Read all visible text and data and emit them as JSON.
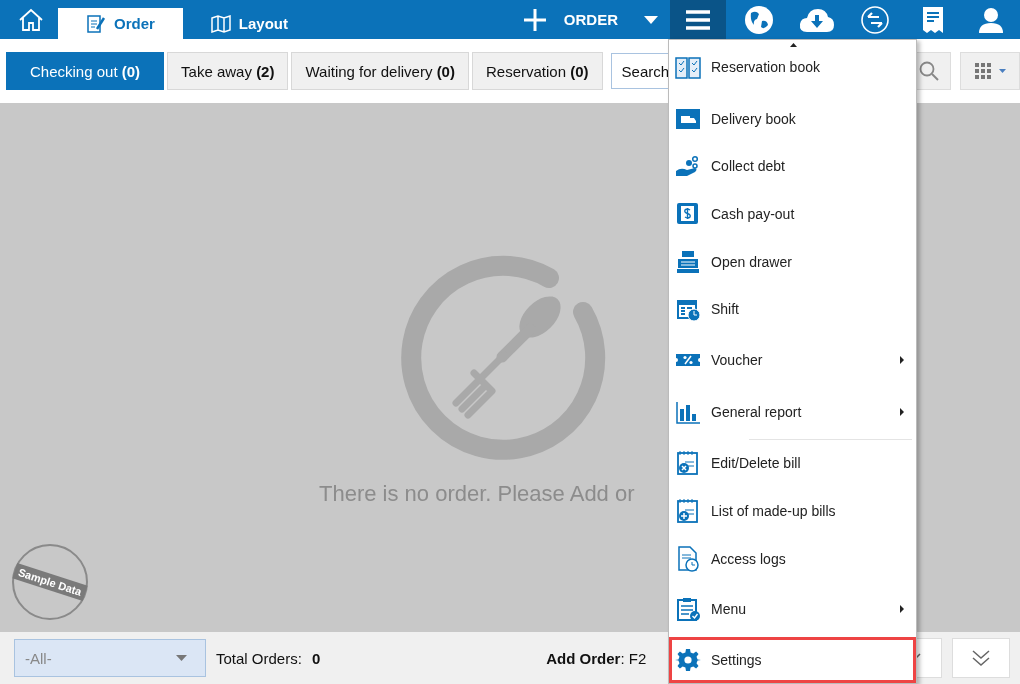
{
  "top_bar": {
    "tabs": [
      {
        "kind": "home",
        "selected": false
      },
      {
        "kind": "order",
        "label": "Order",
        "selected": true
      },
      {
        "kind": "layout",
        "label": "Layout",
        "selected": false
      }
    ],
    "add_button": {
      "label": "ORDER"
    },
    "icons": [
      {
        "kind": "menu",
        "selected": true
      },
      {
        "kind": "globe",
        "selected": false
      },
      {
        "kind": "cloud",
        "selected": false
      },
      {
        "kind": "sync",
        "selected": false
      },
      {
        "kind": "receipt",
        "selected": false
      },
      {
        "kind": "user",
        "selected": false
      }
    ]
  },
  "order_tabs": [
    {
      "label": "Checking out **(0)**",
      "selected": true
    },
    {
      "label": "Take away **(2)**",
      "selected": false
    },
    {
      "label": "Waiting for delivery **(0)**",
      "selected": false
    },
    {
      "label": "Reservation **(0)**",
      "selected": false
    }
  ],
  "search": {
    "placeholder": "Search"
  },
  "empty_message": "There is no order. Please Add or",
  "sample_stamp": "Sample Data",
  "footer": {
    "filter": "-All-",
    "total_label": "Total Orders:",
    "total_value": "0",
    "shortcut": "**Add Order**: F2"
  },
  "menu": [
    {
      "kind": "reservation",
      "label": "Reservation book",
      "submenu": false,
      "highlighted": false
    },
    {
      "kind": "delivery",
      "label": "Delivery book",
      "submenu": false,
      "highlighted": false
    },
    {
      "kind": "debt",
      "label": "Collect debt",
      "submenu": false,
      "highlighted": false
    },
    {
      "kind": "payout",
      "label": "Cash pay-out",
      "submenu": false,
      "highlighted": false
    },
    {
      "kind": "drawer",
      "label": "Open drawer",
      "submenu": false,
      "highlighted": false
    },
    {
      "kind": "shift",
      "label": "Shift",
      "submenu": false,
      "highlighted": false
    },
    {
      "kind": "voucher",
      "label": "Voucher",
      "submenu": true,
      "highlighted": false
    },
    {
      "kind": "report",
      "label": "General report",
      "submenu": true,
      "highlighted": false
    },
    {
      "kind": "divider"
    },
    {
      "kind": "editbill",
      "label": "Edit/Delete bill",
      "submenu": false,
      "highlighted": false
    },
    {
      "kind": "madeup",
      "label": "List of made-up bills",
      "submenu": false,
      "highlighted": false
    },
    {
      "kind": "logs",
      "label": "Access logs",
      "submenu": false,
      "highlighted": false
    },
    {
      "kind": "menu",
      "label": "Menu",
      "submenu": true,
      "highlighted": false
    },
    {
      "kind": "settings",
      "label": "Settings",
      "submenu": false,
      "highlighted": true
    }
  ]
}
